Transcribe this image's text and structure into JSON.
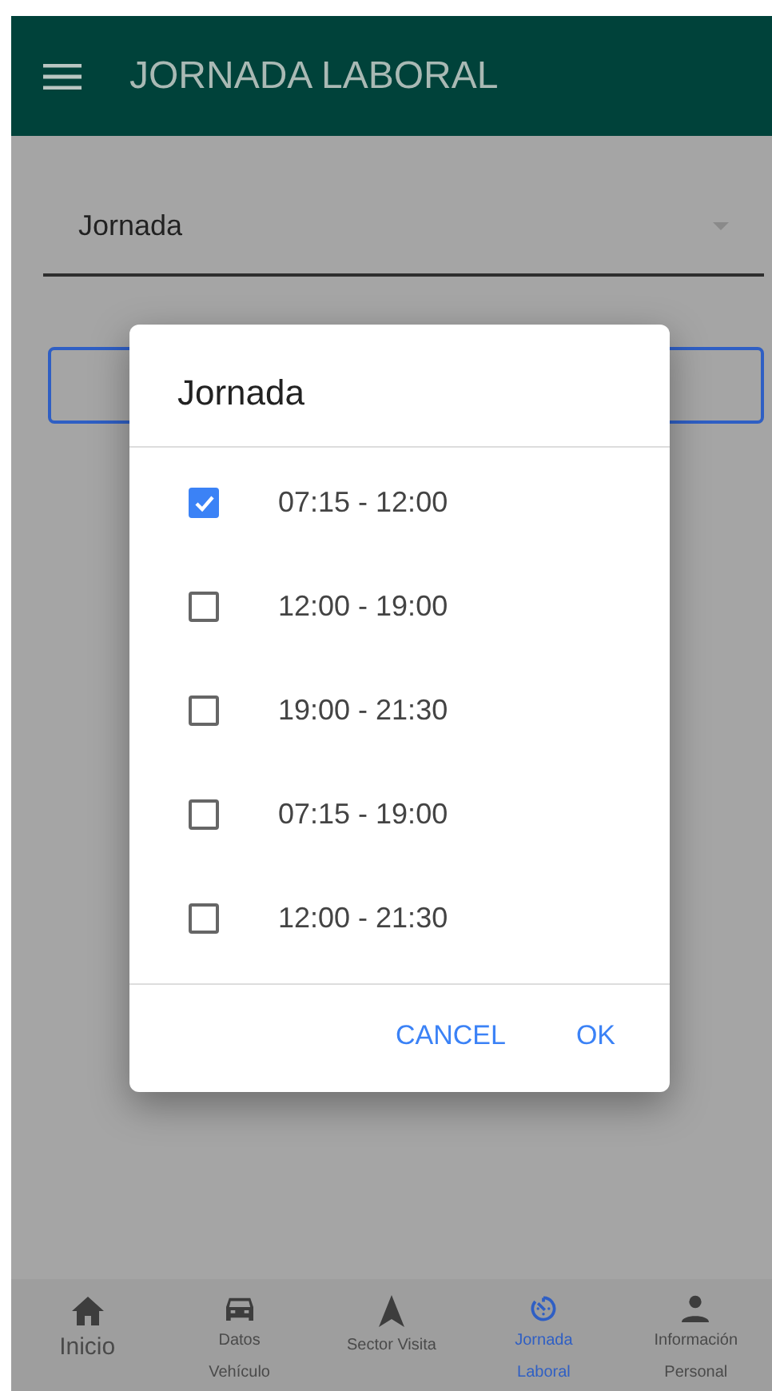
{
  "app_bar": {
    "title": "JORNADA LABORAL"
  },
  "select": {
    "label": "Jornada"
  },
  "dialog": {
    "title": "Jornada",
    "options": [
      {
        "label": "07:15 - 12:00",
        "checked": true
      },
      {
        "label": "12:00 - 19:00",
        "checked": false
      },
      {
        "label": "19:00 - 21:30",
        "checked": false
      },
      {
        "label": "07:15 - 19:00",
        "checked": false
      },
      {
        "label": "12:00 - 21:30",
        "checked": false
      }
    ],
    "buttons": [
      "CANCEL",
      "OK"
    ]
  },
  "bottom_nav": [
    {
      "kind": "home",
      "label": "Inicio",
      "selected": false
    },
    {
      "kind": "car",
      "label": "Datos Vehículo",
      "selected": false
    },
    {
      "kind": "navigation",
      "label": "Sector Visita",
      "selected": false
    },
    {
      "kind": "timer",
      "label": "Jornada Laboral",
      "selected": true
    },
    {
      "kind": "person",
      "label": "Información Personal",
      "selected": false
    }
  ]
}
